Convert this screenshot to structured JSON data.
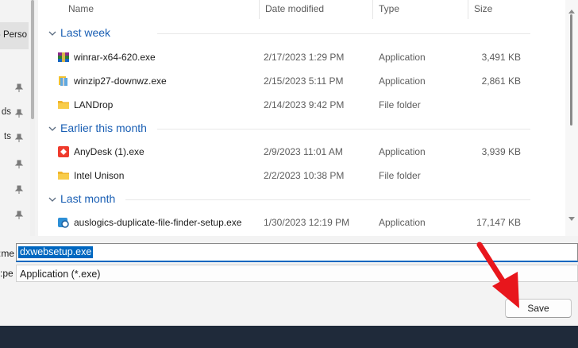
{
  "nav": {
    "selected_label": "- Perso",
    "fragments": [
      "ds",
      "ts"
    ]
  },
  "columns": {
    "name": "Name",
    "date": "Date modified",
    "type": "Type",
    "size": "Size"
  },
  "groups": [
    {
      "title": "Last week",
      "files": [
        {
          "name": "winrar-x64-620.exe",
          "date": "2/17/2023 1:29 PM",
          "type": "Application",
          "size": "3,491 KB",
          "icon": "winrar-icon"
        },
        {
          "name": "winzip27-downwz.exe",
          "date": "2/15/2023 5:11 PM",
          "type": "Application",
          "size": "2,861 KB",
          "icon": "winzip-icon"
        },
        {
          "name": "LANDrop",
          "date": "2/14/2023 9:42 PM",
          "type": "File folder",
          "size": "",
          "icon": "folder-icon"
        }
      ]
    },
    {
      "title": "Earlier this month",
      "files": [
        {
          "name": "AnyDesk (1).exe",
          "date": "2/9/2023 11:01 AM",
          "type": "Application",
          "size": "3,939 KB",
          "icon": "anydesk-icon"
        },
        {
          "name": "Intel Unison",
          "date": "2/2/2023 10:38 PM",
          "type": "File folder",
          "size": "",
          "icon": "folder-icon"
        }
      ]
    },
    {
      "title": "Last month",
      "files": [
        {
          "name": "auslogics-duplicate-file-finder-setup.exe",
          "date": "1/30/2023 12:19 PM",
          "type": "Application",
          "size": "17,147 KB",
          "icon": "auslogics-icon"
        }
      ]
    }
  ],
  "filename_label_fragment": "me:",
  "filetype_label_fragment": "pe:",
  "filename_value": "dxwebsetup.exe",
  "filetype_value": "Application (*.exe)",
  "save_label": "Save",
  "colors": {
    "accent": "#0067c0",
    "group_title": "#1a5fb4",
    "annotation_arrow": "#e8161c",
    "taskbar": "#1f2a3a"
  }
}
